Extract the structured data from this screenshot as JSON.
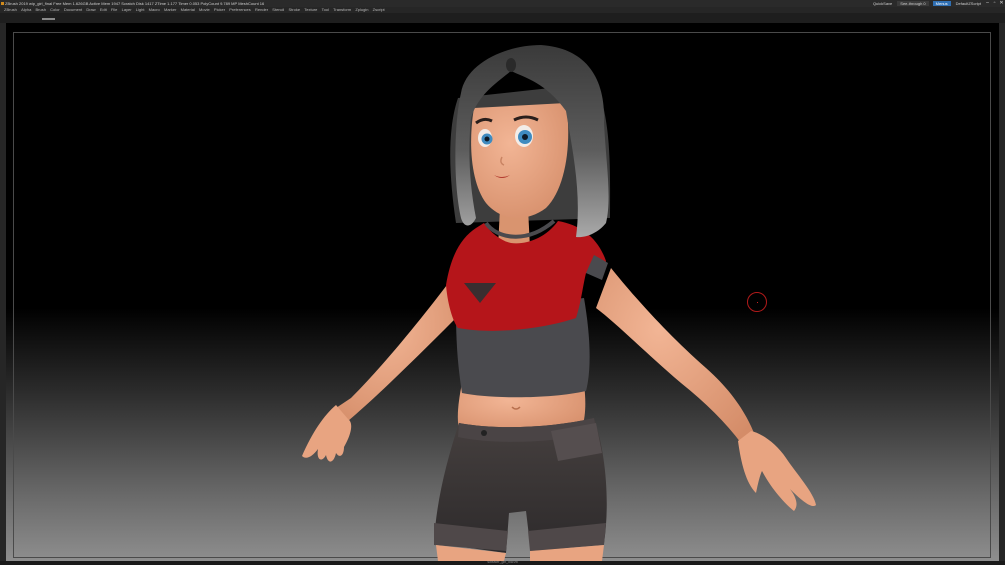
{
  "window": {
    "title": "ZBrush 2019  wip_girl_final  Free Mem 1.626GB  Active Mem 1947  Scratch Disk 1417  ZTime 1.177  Timer 0.053  PolyCount 9.789 MP  MeshCount 16",
    "quicksave_label": "QuickSave",
    "see_through_label": "See-through 0",
    "menus_label": "Menus",
    "default_script_label": "DefaultZScript"
  },
  "menus": [
    "ZBrush",
    "Alpha",
    "Brush",
    "Color",
    "Document",
    "Draw",
    "Edit",
    "File",
    "Layer",
    "Light",
    "Macro",
    "Marker",
    "Material",
    "Movie",
    "Picker",
    "Preferences",
    "Render",
    "Stencil",
    "Stroke",
    "Texture",
    "Tool",
    "Transform",
    "Zplugin",
    "Zscript"
  ],
  "status": {
    "bottom_text": "sweater_girl_low.ztl"
  },
  "colors": {
    "background_top": "#000000",
    "background_bottom": "#8e8e8e",
    "shirt_red": "#b5151a",
    "shirt_gray": "#4a4a4e",
    "shorts": "#3a3536",
    "skin": "#e8a481",
    "hair": "#5a5a5a",
    "cursor_ring": "#b11a1a"
  },
  "icons": {
    "app": "zbrush-logo-icon",
    "minimize": "minimize-icon",
    "maximize": "maximize-icon",
    "close": "close-icon"
  }
}
